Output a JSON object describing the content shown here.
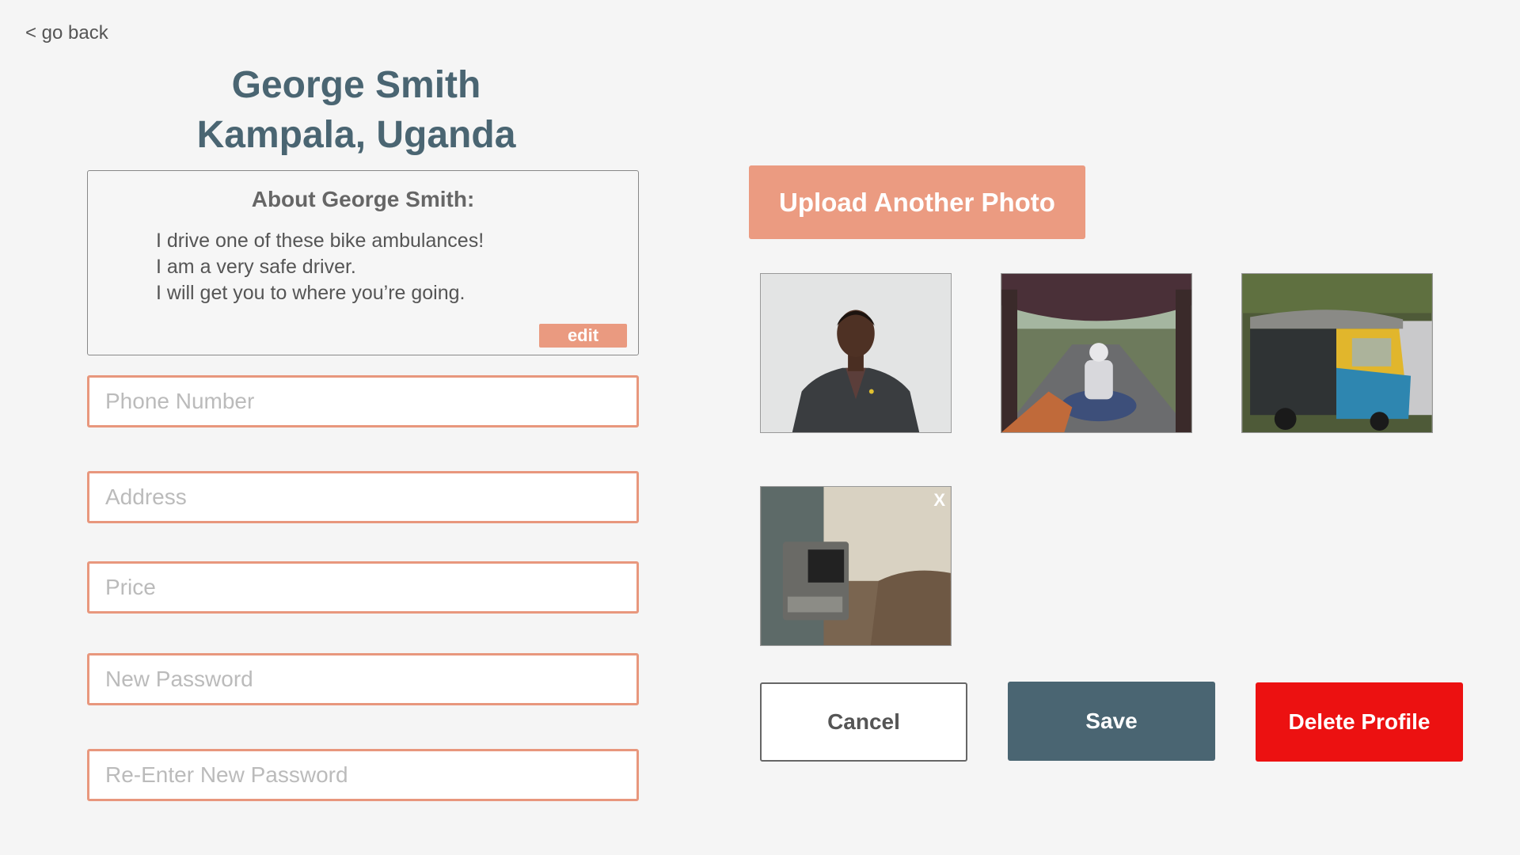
{
  "nav": {
    "back_label": "< go back"
  },
  "profile": {
    "name": "George Smith",
    "location": "Kampala, Uganda"
  },
  "about": {
    "title": "About George Smith:",
    "lines": [
      "I drive one of these bike ambulances!",
      "I am a very safe driver.",
      "I will get you to where you’re going."
    ],
    "edit_label": "edit"
  },
  "form": {
    "phone": {
      "placeholder": "Phone Number",
      "value": ""
    },
    "address": {
      "placeholder": "Address",
      "value": ""
    },
    "price": {
      "placeholder": "Price",
      "value": ""
    },
    "new_password": {
      "placeholder": "New Password",
      "value": ""
    },
    "reenter_password": {
      "placeholder": "Re-Enter New Password",
      "value": ""
    }
  },
  "photos": {
    "upload_label": "Upload Another Photo",
    "remove_label": "X"
  },
  "actions": {
    "cancel_label": "Cancel",
    "save_label": "Save",
    "delete_label": "Delete Profile"
  },
  "colors": {
    "accent": "#eb9b81",
    "heading": "#4a6572",
    "danger": "#ec1111",
    "background": "#f5f5f5"
  }
}
